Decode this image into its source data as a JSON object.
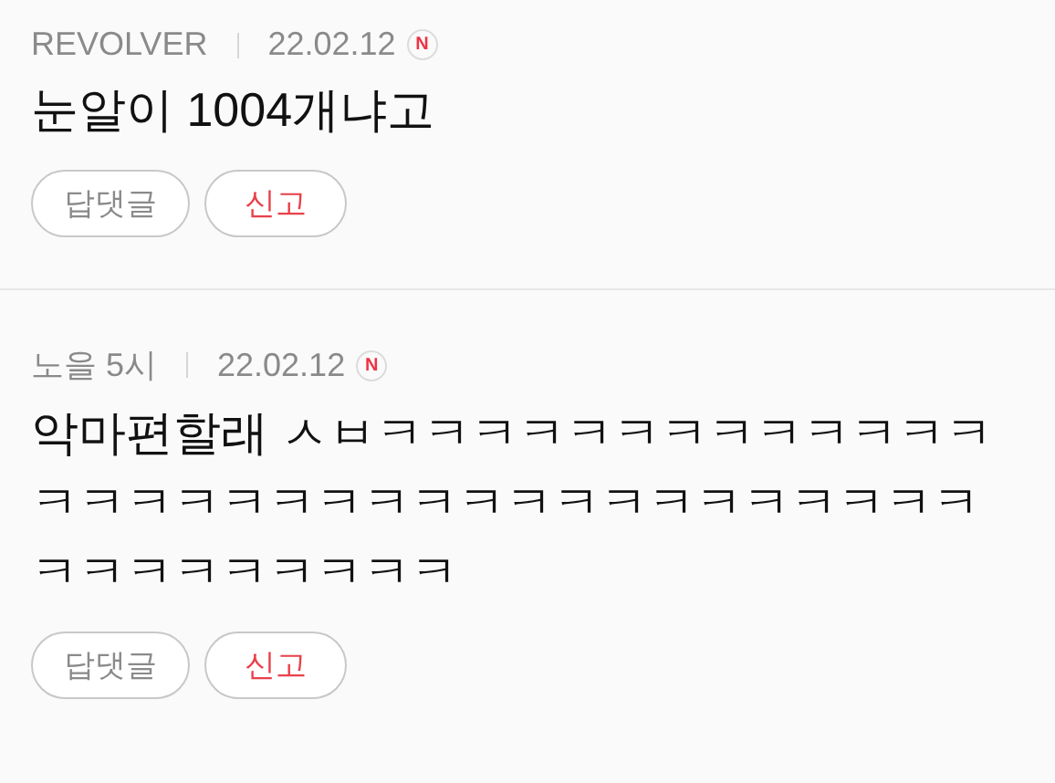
{
  "comments": [
    {
      "author": "REVOLVER",
      "date": "22.02.12",
      "badge": "N",
      "text": "눈알이 1004개냐고",
      "buttons": [
        {
          "label": "답댓글",
          "kind": "reply"
        },
        {
          "label": "신고",
          "kind": "report"
        }
      ]
    },
    {
      "author": "노을 5시",
      "date": "22.02.12",
      "badge": "N",
      "text": "악마편할래 ㅅㅂㅋㅋㅋㅋㅋㅋㅋㅋㅋㅋㅋㅋㅋㅋㅋㅋㅋㅋㅋㅋㅋㅋㅋㅋㅋㅋㅋㅋㅋㅋㅋㅋㅋㅋㅋㅋㅋㅋㅋㅋㅋㅋ",
      "buttons": [
        {
          "label": "답댓글",
          "kind": "reply"
        },
        {
          "label": "신고",
          "kind": "report"
        }
      ]
    }
  ]
}
